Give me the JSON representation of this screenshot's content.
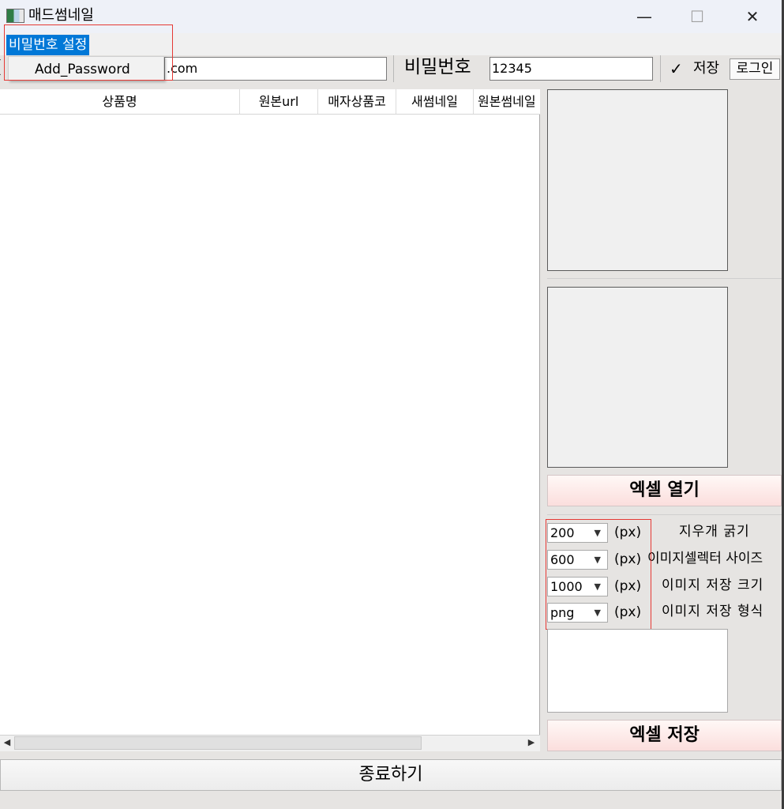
{
  "window": {
    "title": "매드썸네일",
    "icons": {
      "app": "excel-like-app-icon",
      "minimize": "minimize-icon",
      "maximize": "maximize-icon",
      "close": "close-icon"
    }
  },
  "menu": {
    "password_menu": "비밀번호 설정",
    "dropdown_items": [
      "Add_Password"
    ]
  },
  "login": {
    "left_glyph": "(",
    "id_value": ".com",
    "password_label": "비밀번호",
    "password_value": "12345",
    "save_checked": "✓",
    "save_label": "저장",
    "login_button": "로그인"
  },
  "table": {
    "columns": [
      "상품명",
      "원본url",
      "매자상품코",
      "새썸네일",
      "원본썸네일"
    ],
    "rows": []
  },
  "right_panel": {
    "excel_open": "엑셀 열기",
    "options": [
      {
        "value": "200",
        "unit": "(px)",
        "label": "지우개 굵기"
      },
      {
        "value": "600",
        "unit": "(px)",
        "label": "이미지셀렉터 사이즈"
      },
      {
        "value": "1000",
        "unit": "(px)",
        "label": "이미지 저장 크기"
      },
      {
        "value": "png",
        "unit": "(px)",
        "label": "이미지 저장 형식"
      }
    ],
    "excel_save": "엑셀 저장"
  },
  "footer": {
    "exit_button": "종료하기"
  },
  "colors": {
    "menu_highlight": "#0078d7",
    "annotation_box": "#e53935",
    "button_gradient_end": "#fbdedd"
  }
}
